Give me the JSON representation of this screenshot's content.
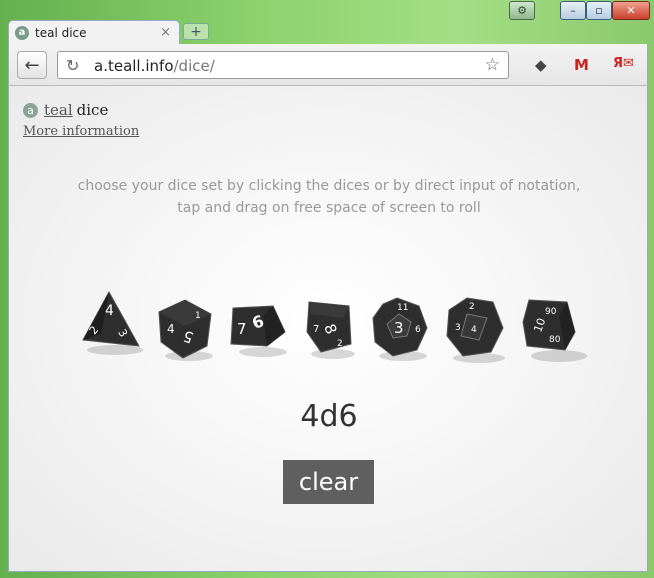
{
  "browser": {
    "tab_title": "teal dice",
    "tab_favicon_letter": "a",
    "tab_close_glyph": "×",
    "new_tab_glyph": "+",
    "url_host": "a.teall.info",
    "url_path": "/dice/",
    "window_controls": {
      "minimize": "–",
      "maximize": "▫",
      "close": "✕"
    },
    "icons": [
      "settings-icon",
      "back-arrow-icon",
      "reload-icon",
      "star-icon",
      "feedly-extension-icon",
      "gmail-extension-icon",
      "yandex-mail-extension-icon"
    ]
  },
  "page": {
    "brand_logo_letter": "a",
    "brand_link": "teal",
    "brand_rest": "dice",
    "more_info": "More information",
    "instructions_line1": "choose your dice set by clicking the dices or by direct input of notation,",
    "instructions_line2": "tap and drag on free space of screen to roll",
    "notation": "4d6",
    "clear_label": "clear"
  },
  "dice": [
    {
      "type": "d4",
      "faces_shown": [
        "4",
        "2",
        "3"
      ]
    },
    {
      "type": "d6",
      "faces_shown": [
        "4",
        "5",
        "1"
      ]
    },
    {
      "type": "d8",
      "faces_shown": [
        "7",
        "6"
      ]
    },
    {
      "type": "d10",
      "faces_shown": [
        "8",
        "7",
        "2"
      ]
    },
    {
      "type": "d12",
      "faces_shown": [
        "3",
        "11",
        "6"
      ]
    },
    {
      "type": "d20",
      "faces_shown": [
        "2",
        "3",
        "4"
      ]
    },
    {
      "type": "d100",
      "faces_shown": [
        "10",
        "90",
        "80"
      ]
    }
  ],
  "colors": {
    "die_face": "#2e2e2e",
    "die_numbers": "#ffffff",
    "clear_button": "#5f5f5f",
    "instructions_text": "#999999"
  }
}
